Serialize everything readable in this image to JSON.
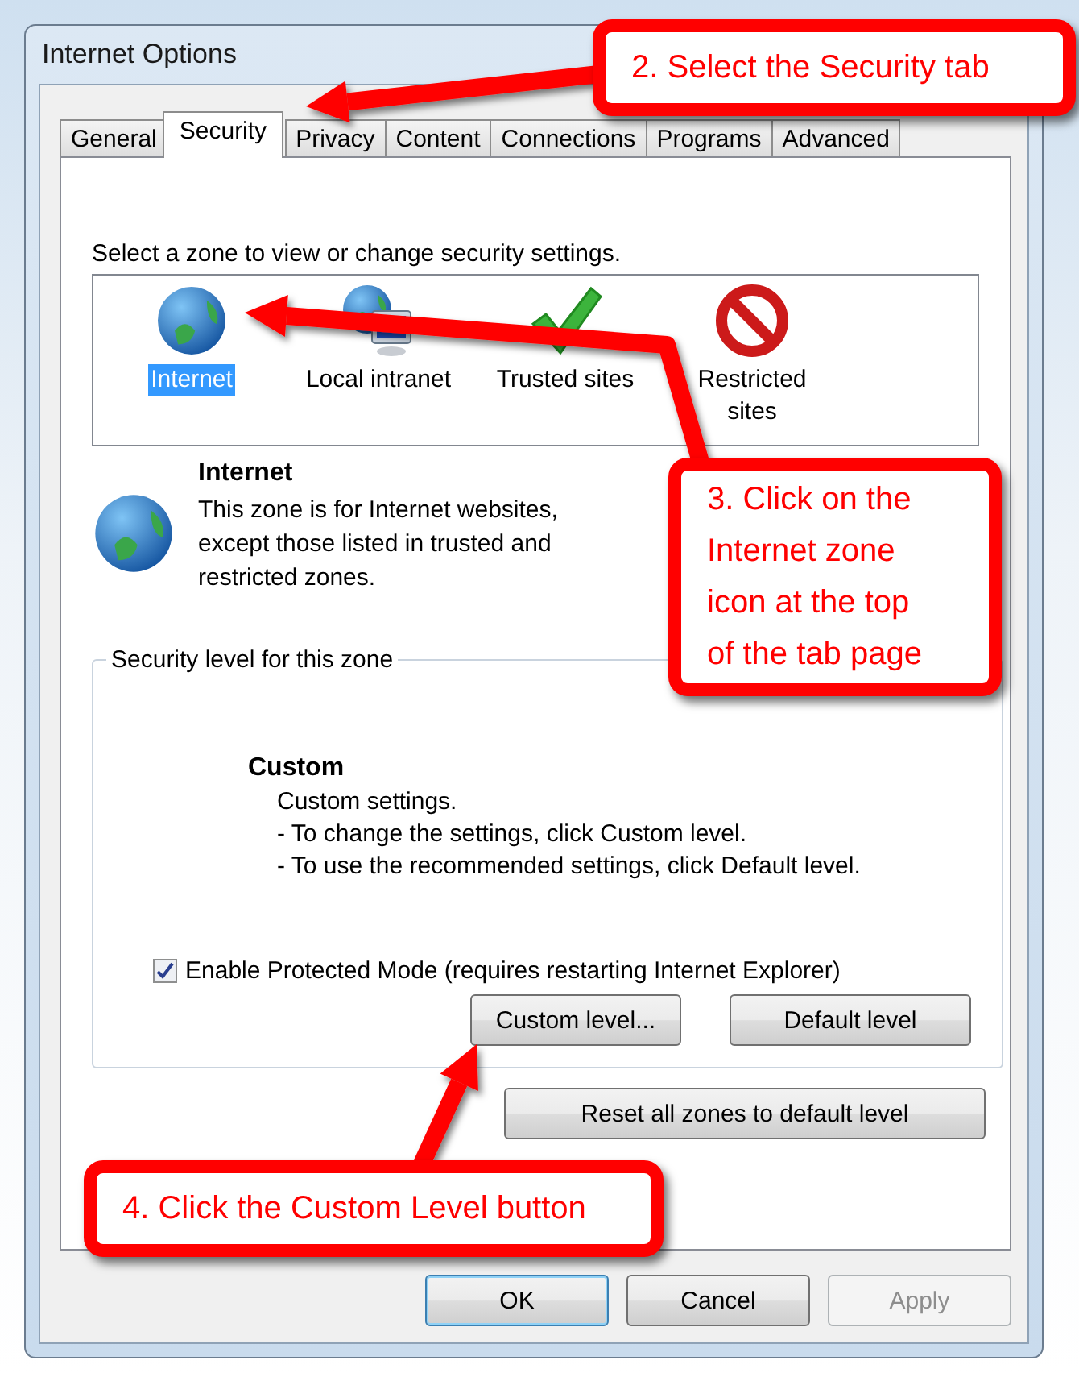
{
  "window": {
    "title": "Internet Options"
  },
  "tabs": [
    {
      "label": "General",
      "selected": false
    },
    {
      "label": "Security",
      "selected": true
    },
    {
      "label": "Privacy",
      "selected": false
    },
    {
      "label": "Content",
      "selected": false
    },
    {
      "label": "Connections",
      "selected": false
    },
    {
      "label": "Programs",
      "selected": false
    },
    {
      "label": "Advanced",
      "selected": false
    }
  ],
  "zones_prompt": "Select a zone to view or change security settings.",
  "zones": [
    {
      "label": "Internet",
      "kind": "globe",
      "selected": true
    },
    {
      "label": "Local intranet",
      "kind": "network",
      "selected": false
    },
    {
      "label": "Trusted sites",
      "kind": "check",
      "selected": false
    },
    {
      "label": "Restricted sites",
      "kind": "blocked",
      "selected": false
    }
  ],
  "zone_info": {
    "title": "Internet",
    "description": "This zone is for Internet websites, except those listed in trusted and restricted zones."
  },
  "security_level": {
    "legend": "Security level for this zone",
    "level_name": "Custom",
    "lines": [
      "Custom settings.",
      "- To change the settings, click Custom level.",
      "- To use the recommended settings, click Default level."
    ],
    "protected_mode": {
      "label": "Enable Protected Mode (requires restarting Internet Explorer)",
      "checked": true
    },
    "buttons": [
      {
        "label": "Custom level..."
      },
      {
        "label": "Default level"
      }
    ]
  },
  "reset_button": "Reset all zones to default level",
  "dialog_buttons": [
    {
      "label": "OK",
      "default": true,
      "disabled": false
    },
    {
      "label": "Cancel",
      "default": false,
      "disabled": false
    },
    {
      "label": "Apply",
      "default": false,
      "disabled": true
    }
  ],
  "callouts": [
    {
      "text": "2.  Select the Security tab"
    },
    {
      "text": "3.  Click on the\nInternet zone\nicon at the top\nof the tab page"
    },
    {
      "text": "4.  Click the Custom Level button"
    }
  ]
}
